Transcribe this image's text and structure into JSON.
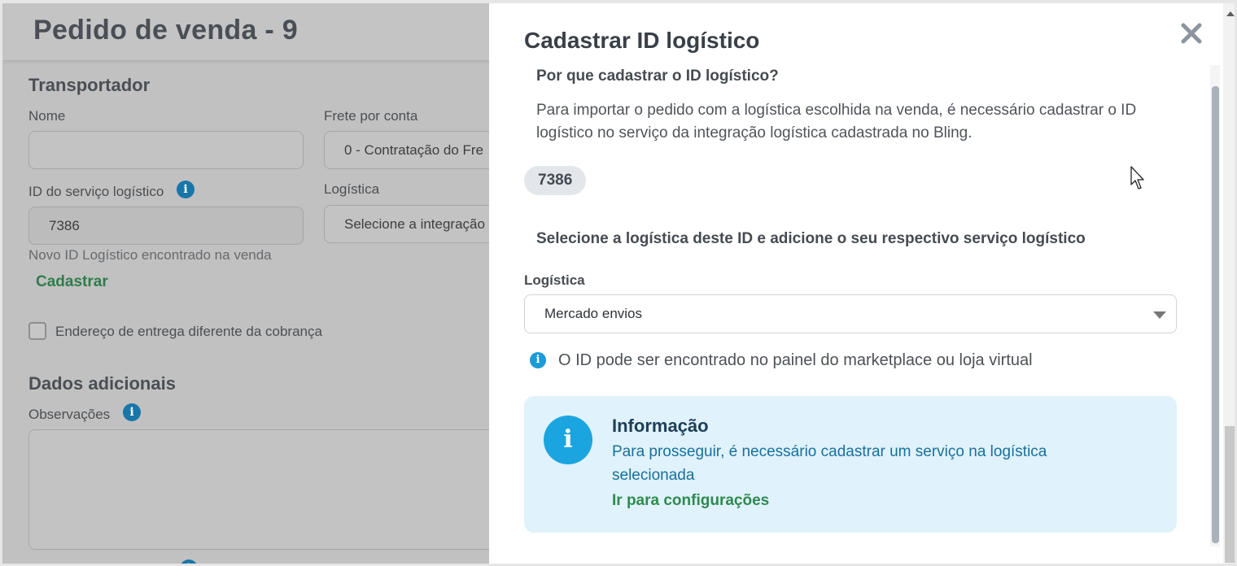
{
  "page": {
    "title": "Pedido de venda - 9",
    "transportador": {
      "section_title": "Transportador",
      "nome_label": "Nome",
      "nome_value": "",
      "frete_label": "Frete por conta",
      "frete_value": "0 - Contratação do Fre",
      "id_servico_label": "ID do serviço logístico",
      "id_servico_value": "7386",
      "id_hint": "Novo ID Logístico encontrado na venda",
      "cadastrar_link": "Cadastrar",
      "logistica_label": "Logística",
      "logistica_value": "Selecione a integração",
      "endereco_checkbox_label": "Endereço de entrega diferente da cobrança"
    },
    "dados_adicionais": {
      "section_title": "Dados adicionais",
      "observacoes_label": "Observações"
    }
  },
  "modal": {
    "title": "Cadastrar ID logístico",
    "question_title": "Por que cadastrar o ID logístico?",
    "paragraph": "Para importar o pedido com a logística escolhida na venda, é necessário cadastrar o ID logístico no serviço da integração logística cadastrada no Bling.",
    "id_pill": "7386",
    "select_title": "Selecione a logística deste ID e adicione o seu respectivo serviço logístico",
    "logistica_label": "Logística",
    "logistica_selected": "Mercado envios",
    "hint": "O ID pode ser encontrado no painel do marketplace ou loja virtual",
    "alert": {
      "title": "Informação",
      "text": "Para prosseguir, é necessário cadastrar um serviço na logística selecionada",
      "link": "Ir para configurações"
    }
  },
  "icons": {
    "close": "close-icon",
    "info": "info-icon",
    "caret": "chevron-down-icon"
  },
  "colors": {
    "accent_green": "#2e8a4f",
    "info_blue": "#1ba5e0",
    "alert_bg": "#e0f2fb"
  }
}
